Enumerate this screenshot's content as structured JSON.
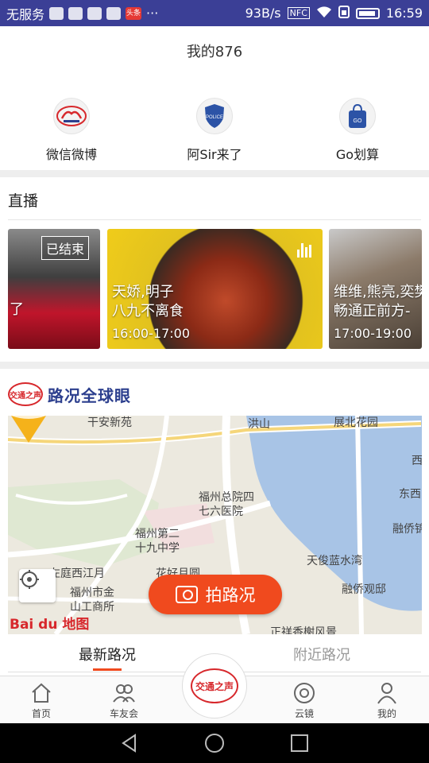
{
  "status_bar": {
    "carrier": "无服务",
    "notification_badge": "头条",
    "more": "···",
    "speed": "93B/s",
    "nfc": "NFC",
    "time": "16:59"
  },
  "header": {
    "title": "我的876"
  },
  "quick_entries": [
    {
      "label": "微信微博",
      "icon": "brand-logo-icon"
    },
    {
      "label": "阿Sir来了",
      "icon": "police-badge-icon",
      "badge_text": "POLICE"
    },
    {
      "label": "Go划算",
      "icon": "shopping-bag-icon",
      "badge_text": "GO"
    }
  ],
  "live": {
    "title": "直播",
    "cards": [
      {
        "status": "已结束",
        "title_line": "了"
      },
      {
        "title_line1": "天娇,明子",
        "title_line2": "八九不离食",
        "time": "16:00-17:00"
      },
      {
        "title_line1": "维维,熊亮,奕樊",
        "title_line2": "畅通正前方-",
        "time": "17:00-19:00"
      }
    ]
  },
  "road": {
    "brand_text": "交通之声",
    "title": "路况全球眼",
    "map_labels": {
      "hongshan": "洪山",
      "xianxinyuan": "干安新苑",
      "zhanbeixiyu": "展北花园",
      "hospital": "福州总院四七六医院",
      "hospital_l1": "福州总院四",
      "hospital_l2": "七六医院",
      "school_l1": "福州第二",
      "school_l2": "十九中学",
      "xijiangyue": "左庭西江月",
      "huahaoyue": "花好月圆",
      "gongshang_l1": "福州市金",
      "gongshang_l2": "山工商所",
      "tianjun": "天俊蓝水湾",
      "rongqiao": "融侨观邸",
      "rongqiaojin": "融侨锦",
      "xi": "西",
      "dongxi": "东西",
      "bottom": "正祥香榭风景"
    },
    "map_provider": "Bai du 地图",
    "report_button": "拍路况"
  },
  "tabs": [
    {
      "label": "最新路况",
      "active": true
    },
    {
      "label": "附近路况",
      "active": false
    }
  ],
  "bottom_nav": [
    {
      "label": "首页",
      "icon": "home-icon"
    },
    {
      "label": "车友会",
      "icon": "users-icon"
    },
    {
      "label": "云镜",
      "icon": "lens-icon"
    },
    {
      "label": "我的",
      "icon": "person-icon"
    }
  ],
  "center_button": {
    "label": "交通之声"
  },
  "colors": {
    "status_bar": "#3b3f96",
    "accent": "#f04a1e",
    "brand_red": "#d7282c",
    "brand_blue": "#2c3f8e"
  }
}
